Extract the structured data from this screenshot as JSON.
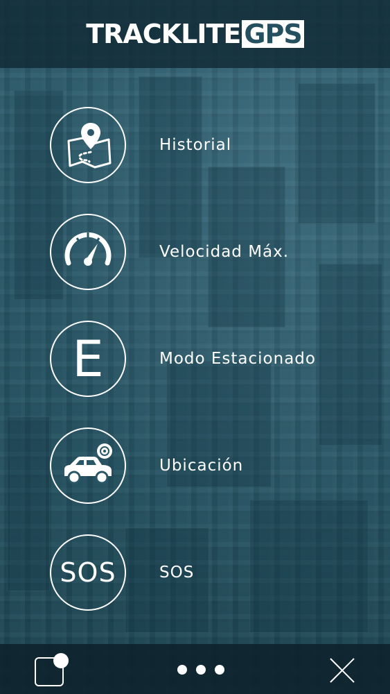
{
  "app": {
    "logo_main": "TRACKLITE",
    "logo_suffix": "GPS"
  },
  "menu": [
    {
      "label": "Historial",
      "icon": "map-pin-route-icon"
    },
    {
      "label": "Velocidad Máx.",
      "icon": "speedometer-icon"
    },
    {
      "label": "Modo Estacionado",
      "icon": "letter-e-icon",
      "glyph": "E"
    },
    {
      "label": "Ubicación",
      "icon": "car-location-icon"
    },
    {
      "label": "SOS",
      "icon": "sos-icon",
      "glyph": "SOS"
    }
  ],
  "bottom_bar": {
    "left_icon": "app-switch-icon",
    "center_icon": "more-dots-icon",
    "right_icon": "close-icon"
  },
  "colors": {
    "header_bg": "#102a34",
    "background": "#2a5767",
    "foreground": "#ffffff"
  }
}
